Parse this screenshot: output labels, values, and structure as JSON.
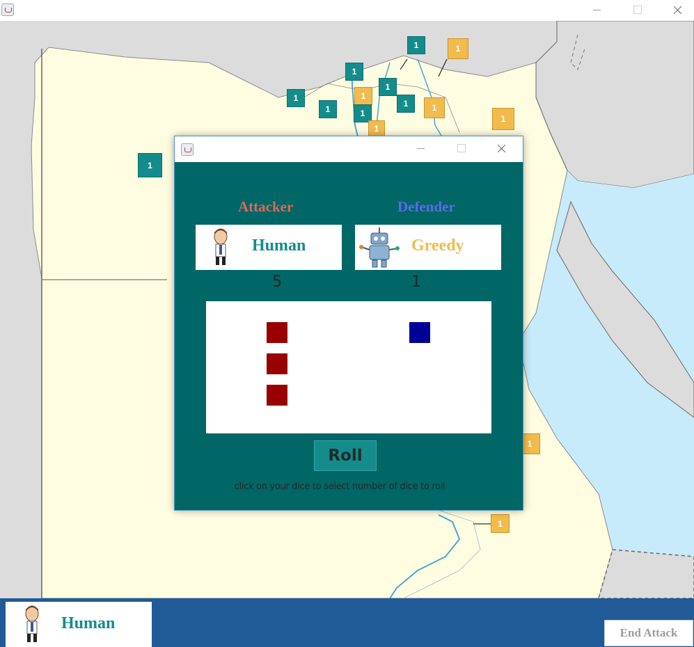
{
  "window": {
    "icon": "java-cup-icon"
  },
  "map": {
    "territories": [
      {
        "owner": "teal",
        "label": "1"
      },
      {
        "owner": "gold",
        "label": "1"
      },
      {
        "owner": "teal",
        "label": "1"
      },
      {
        "owner": "teal",
        "label": "1"
      },
      {
        "owner": "gold",
        "label": "1"
      },
      {
        "owner": "teal",
        "label": "1"
      },
      {
        "owner": "teal",
        "label": "1"
      },
      {
        "owner": "teal",
        "label": "1"
      },
      {
        "owner": "gold",
        "label": "1"
      },
      {
        "owner": "teal",
        "label": "1"
      },
      {
        "owner": "gold",
        "label": "1"
      },
      {
        "owner": "gold",
        "label": "1"
      },
      {
        "owner": "gold",
        "label": "1"
      },
      {
        "owner": "teal",
        "label": "1"
      },
      {
        "owner": "gold",
        "label": "1"
      },
      {
        "owner": "gold",
        "label": "1"
      }
    ]
  },
  "dialog": {
    "attacker_label": "Attacker",
    "defender_label": "Defender",
    "attacker": {
      "name": "Human",
      "troops": "5",
      "avatar": "human-avatar-icon"
    },
    "defender": {
      "name": "Greedy",
      "troops": "1",
      "avatar": "robot-avatar-icon"
    },
    "attacker_dice": 3,
    "defender_dice": 1,
    "roll_label": "Roll",
    "hint": "click on your dice to select number of dice to roll"
  },
  "bottom_bar": {
    "current_player": "Human",
    "end_attack_label": "End Attack"
  },
  "colors": {
    "teal": "#148c8c",
    "gold": "#f1bc4d",
    "attacker_label": "#e0675f",
    "defender_label": "#5b6be8",
    "attacker_die": "#990000",
    "defender_die": "#000099",
    "dialog_bg": "#006666",
    "bottom_bar": "#205b98"
  }
}
